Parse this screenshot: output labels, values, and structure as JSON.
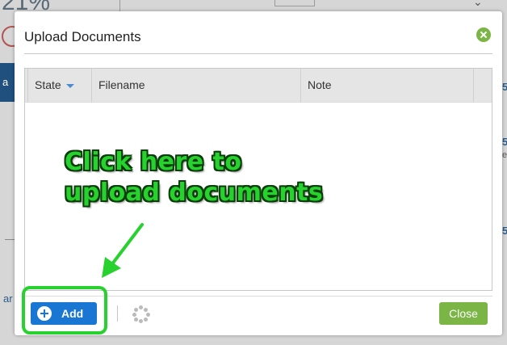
{
  "dialog": {
    "title": "Upload Documents",
    "columns": [
      {
        "label": "State",
        "sortable": true
      },
      {
        "label": "Filename"
      },
      {
        "label": "Note"
      },
      {
        "label": ""
      }
    ],
    "add_label": "Add",
    "close_label": "Close"
  },
  "annotation": {
    "line1": "Click here to",
    "line2": "upload documents"
  },
  "background": {
    "top_left_text": "21%",
    "left_link_text": "ar",
    "right_digits": [
      "5",
      "5",
      "5",
      "e"
    ]
  },
  "colors": {
    "primary_blue": "#1976d2",
    "accent_green": "#7ab546",
    "annotation_green": "#27d12e"
  },
  "icons": {
    "close_x": "close-circle-icon",
    "add": "plus-circle-icon",
    "spinner": "loading-spinner-icon",
    "sort": "caret-down-icon"
  }
}
